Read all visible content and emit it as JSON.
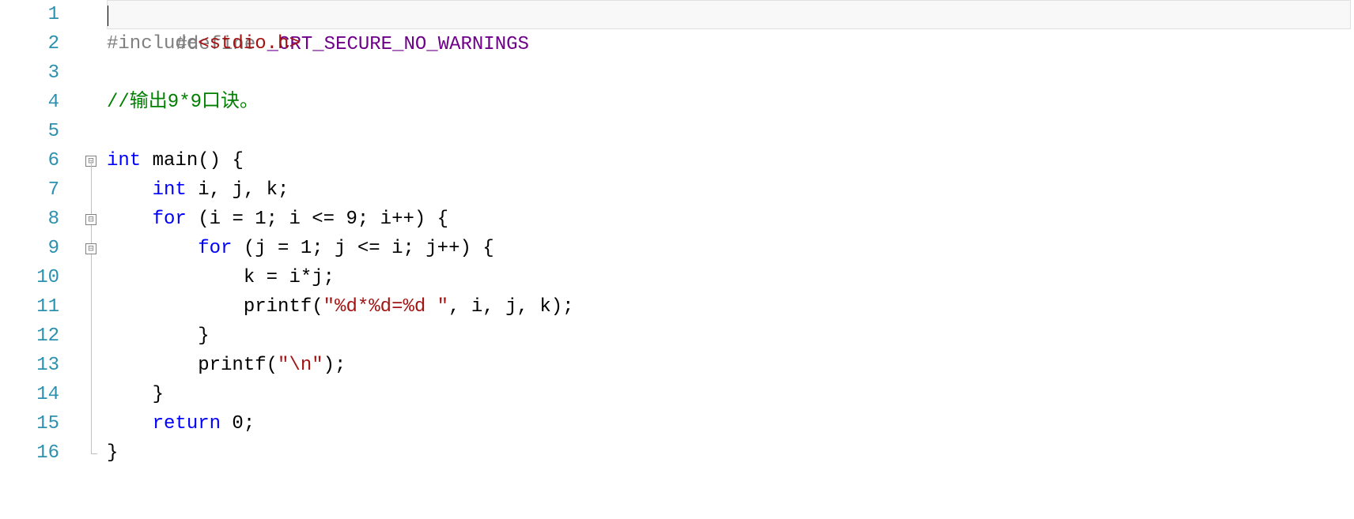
{
  "lines": {
    "count": 16,
    "numbers": [
      "1",
      "2",
      "3",
      "4",
      "5",
      "6",
      "7",
      "8",
      "9",
      "10",
      "11",
      "12",
      "13",
      "14",
      "15",
      "16"
    ]
  },
  "fold": {
    "6": "box",
    "8": "box",
    "9": "box"
  },
  "code": {
    "l1": {
      "preproc": "#define",
      "space": " ",
      "macro": "_CRT_SECURE_NO_WARNINGS"
    },
    "l2": {
      "preproc": "#include",
      "inc": "<stdio.h>"
    },
    "l4": {
      "comment": "//输出9*9口诀。"
    },
    "l6": {
      "kw_int": "int",
      "space1": " ",
      "main": "main() {"
    },
    "l7": {
      "indent": "    ",
      "kw_int": "int",
      "rest": " i, j, k;"
    },
    "l8": {
      "indent": "    ",
      "kw_for": "for",
      "rest": " (i = 1; i <= 9; i++) {"
    },
    "l9": {
      "indent": "        ",
      "kw_for": "for",
      "rest": " (j = 1; j <= i; j++) {"
    },
    "l10": {
      "text": "            k = i*j;"
    },
    "l11": {
      "indent": "            ",
      "func": "printf(",
      "str": "\"%d*%d=%d \"",
      "rest": ", i, j, k);"
    },
    "l12": {
      "text": "        }"
    },
    "l13": {
      "indent": "        ",
      "func": "printf(",
      "str": "\"\\n\"",
      "rest": ");"
    },
    "l14": {
      "text": "    }"
    },
    "l15": {
      "indent": "    ",
      "kw_return": "return",
      "rest": " 0;"
    },
    "l16": {
      "text": "}"
    }
  },
  "fold_glyph": "⊟"
}
